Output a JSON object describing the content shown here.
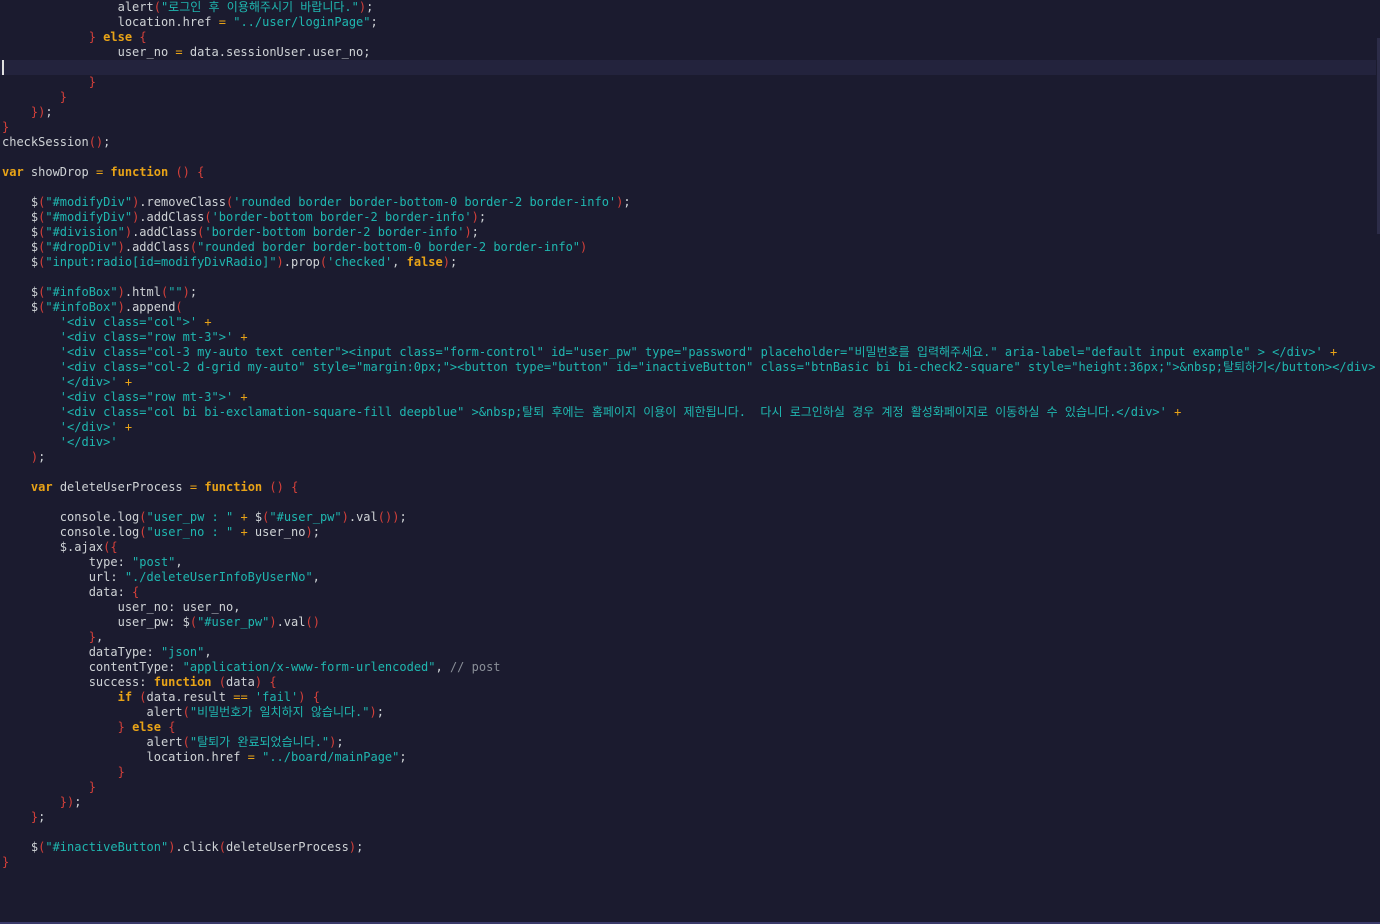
{
  "editor": {
    "lines": [
      [
        [
          "",
          "                "
        ],
        [
          "fn",
          "alert"
        ],
        [
          "br",
          "("
        ],
        [
          "str",
          "\"로그인 후 이용해주시기 바랍니다.\""
        ],
        [
          "br",
          ")"
        ],
        [
          "",
          ";"
        ]
      ],
      [
        [
          "",
          "                location.href "
        ],
        [
          "op",
          "="
        ],
        [
          "",
          " "
        ],
        [
          "str",
          "\"../user/loginPage\""
        ],
        [
          "",
          ";"
        ]
      ],
      [
        [
          "",
          "            "
        ],
        [
          "br",
          "}"
        ],
        [
          "",
          " "
        ],
        [
          "kw",
          "else"
        ],
        [
          "",
          " "
        ],
        [
          "br",
          "{"
        ]
      ],
      [
        [
          "",
          "                user_no "
        ],
        [
          "op",
          "="
        ],
        [
          "",
          " data.sessionUser.user_no;"
        ]
      ],
      [
        [
          "",
          ""
        ]
      ],
      [
        [
          "",
          "            "
        ],
        [
          "br",
          "}"
        ]
      ],
      [
        [
          "",
          "        "
        ],
        [
          "br",
          "}"
        ]
      ],
      [
        [
          "",
          "    "
        ],
        [
          "br",
          "})"
        ],
        [
          "",
          ";"
        ]
      ],
      [
        [
          "br",
          "}"
        ]
      ],
      [
        [
          "",
          "checkSession"
        ],
        [
          "br",
          "()"
        ],
        [
          "",
          ";"
        ]
      ],
      [
        [
          "",
          ""
        ]
      ],
      [
        [
          "kw",
          "var"
        ],
        [
          "",
          " showDrop "
        ],
        [
          "op",
          "="
        ],
        [
          "",
          " "
        ],
        [
          "kw",
          "function"
        ],
        [
          "",
          " "
        ],
        [
          "br",
          "()"
        ],
        [
          "",
          " "
        ],
        [
          "br",
          "{"
        ]
      ],
      [
        [
          "",
          ""
        ]
      ],
      [
        [
          "",
          "    $"
        ],
        [
          "br",
          "("
        ],
        [
          "str",
          "\"#modifyDiv\""
        ],
        [
          "br",
          ")"
        ],
        [
          "",
          ".removeClass"
        ],
        [
          "br",
          "("
        ],
        [
          "str",
          "'rounded border border-bottom-0 border-2 border-info'"
        ],
        [
          "br",
          ")"
        ],
        [
          "",
          ";"
        ]
      ],
      [
        [
          "",
          "    $"
        ],
        [
          "br",
          "("
        ],
        [
          "str",
          "\"#modifyDiv\""
        ],
        [
          "br",
          ")"
        ],
        [
          "",
          ".addClass"
        ],
        [
          "br",
          "("
        ],
        [
          "str",
          "'border-bottom border-2 border-info'"
        ],
        [
          "br",
          ")"
        ],
        [
          "",
          ";"
        ]
      ],
      [
        [
          "",
          "    $"
        ],
        [
          "br",
          "("
        ],
        [
          "str",
          "\"#division\""
        ],
        [
          "br",
          ")"
        ],
        [
          "",
          ".addClass"
        ],
        [
          "br",
          "("
        ],
        [
          "str",
          "'border-bottom border-2 border-info'"
        ],
        [
          "br",
          ")"
        ],
        [
          "",
          ";"
        ]
      ],
      [
        [
          "",
          "    $"
        ],
        [
          "br",
          "("
        ],
        [
          "str",
          "\"#dropDiv\""
        ],
        [
          "br",
          ")"
        ],
        [
          "",
          ".addClass"
        ],
        [
          "br",
          "("
        ],
        [
          "str",
          "\"rounded border border-bottom-0 border-2 border-info\""
        ],
        [
          "br",
          ")"
        ]
      ],
      [
        [
          "",
          "    $"
        ],
        [
          "br",
          "("
        ],
        [
          "str",
          "\"input:radio[id=modifyDivRadio]\""
        ],
        [
          "br",
          ")"
        ],
        [
          "",
          ".prop"
        ],
        [
          "br",
          "("
        ],
        [
          "str",
          "'checked'"
        ],
        [
          "",
          ", "
        ],
        [
          "kw",
          "false"
        ],
        [
          "br",
          ")"
        ],
        [
          "",
          ";"
        ]
      ],
      [
        [
          "",
          ""
        ]
      ],
      [
        [
          "",
          "    $"
        ],
        [
          "br",
          "("
        ],
        [
          "str",
          "\"#infoBox\""
        ],
        [
          "br",
          ")"
        ],
        [
          "",
          ".html"
        ],
        [
          "br",
          "("
        ],
        [
          "str",
          "\"\""
        ],
        [
          "br",
          ")"
        ],
        [
          "",
          ";"
        ]
      ],
      [
        [
          "",
          "    $"
        ],
        [
          "br",
          "("
        ],
        [
          "str",
          "\"#infoBox\""
        ],
        [
          "br",
          ")"
        ],
        [
          "",
          ".append"
        ],
        [
          "br",
          "("
        ]
      ],
      [
        [
          "",
          "        "
        ],
        [
          "str",
          "'<div class=\"col\">'"
        ],
        [
          "",
          " "
        ],
        [
          "op",
          "+"
        ]
      ],
      [
        [
          "",
          "        "
        ],
        [
          "str",
          "'<div class=\"row mt-3\">'"
        ],
        [
          "",
          " "
        ],
        [
          "op",
          "+"
        ]
      ],
      [
        [
          "",
          "        "
        ],
        [
          "str",
          "'<div class=\"col-3 my-auto text center\"><input class=\"form-control\" id=\"user_pw\" type=\"password\" placeholder=\"비밀번호를 입력해주세요.\" aria-label=\"default input example\" > </div>'"
        ],
        [
          "",
          " "
        ],
        [
          "op",
          "+"
        ]
      ],
      [
        [
          "",
          "        "
        ],
        [
          "str",
          "'<div class=\"col-2 d-grid my-auto\" style=\"margin:0px;\"><button type=\"button\" id=\"inactiveButton\" class=\"btnBasic bi bi-check2-square\" style=\"height:36px;\">&nbsp;탈퇴하기</button></div>'"
        ],
        [
          "",
          " "
        ],
        [
          "op",
          "+"
        ]
      ],
      [
        [
          "",
          "        "
        ],
        [
          "str",
          "'</div>'"
        ],
        [
          "",
          " "
        ],
        [
          "op",
          "+"
        ]
      ],
      [
        [
          "",
          "        "
        ],
        [
          "str",
          "'<div class=\"row mt-3\">'"
        ],
        [
          "",
          " "
        ],
        [
          "op",
          "+"
        ]
      ],
      [
        [
          "",
          "        "
        ],
        [
          "str",
          "'<div class=\"col bi bi-exclamation-square-fill deepblue\" >&nbsp;탈퇴 후에는 홈페이지 이용이 제한됩니다.  다시 로그인하실 경우 계정 활성화페이지로 이동하실 수 있습니다.</div>'"
        ],
        [
          "",
          " "
        ],
        [
          "op",
          "+"
        ]
      ],
      [
        [
          "",
          "        "
        ],
        [
          "str",
          "'</div>'"
        ],
        [
          "",
          " "
        ],
        [
          "op",
          "+"
        ]
      ],
      [
        [
          "",
          "        "
        ],
        [
          "str",
          "'</div>'"
        ]
      ],
      [
        [
          "",
          "    "
        ],
        [
          "br",
          ")"
        ],
        [
          "",
          ";"
        ]
      ],
      [
        [
          "",
          ""
        ]
      ],
      [
        [
          "",
          "    "
        ],
        [
          "kw",
          "var"
        ],
        [
          "",
          " deleteUserProcess "
        ],
        [
          "op",
          "="
        ],
        [
          "",
          " "
        ],
        [
          "kw",
          "function"
        ],
        [
          "",
          " "
        ],
        [
          "br",
          "()"
        ],
        [
          "",
          " "
        ],
        [
          "br",
          "{"
        ]
      ],
      [
        [
          "",
          ""
        ]
      ],
      [
        [
          "",
          "        console.log"
        ],
        [
          "br",
          "("
        ],
        [
          "str",
          "\"user_pw : \""
        ],
        [
          "",
          " "
        ],
        [
          "op",
          "+"
        ],
        [
          "",
          " $"
        ],
        [
          "br",
          "("
        ],
        [
          "str",
          "\"#user_pw\""
        ],
        [
          "br",
          ")"
        ],
        [
          "",
          ".val"
        ],
        [
          "br",
          "())"
        ],
        [
          "",
          ";"
        ]
      ],
      [
        [
          "",
          "        console.log"
        ],
        [
          "br",
          "("
        ],
        [
          "str",
          "\"user_no : \""
        ],
        [
          "",
          " "
        ],
        [
          "op",
          "+"
        ],
        [
          "",
          " user_no"
        ],
        [
          "br",
          ")"
        ],
        [
          "",
          ";"
        ]
      ],
      [
        [
          "",
          "        $.ajax"
        ],
        [
          "br",
          "({"
        ]
      ],
      [
        [
          "",
          "            type: "
        ],
        [
          "str",
          "\"post\""
        ],
        [
          "",
          ","
        ]
      ],
      [
        [
          "",
          "            url: "
        ],
        [
          "str",
          "\"./deleteUserInfoByUserNo\""
        ],
        [
          "",
          ","
        ]
      ],
      [
        [
          "",
          "            data: "
        ],
        [
          "br",
          "{"
        ]
      ],
      [
        [
          "",
          "                user_no: user_no,"
        ]
      ],
      [
        [
          "",
          "                user_pw: $"
        ],
        [
          "br",
          "("
        ],
        [
          "str",
          "\"#user_pw\""
        ],
        [
          "br",
          ")"
        ],
        [
          "",
          ".val"
        ],
        [
          "br",
          "()"
        ]
      ],
      [
        [
          "",
          "            "
        ],
        [
          "br",
          "}"
        ],
        [
          "",
          ","
        ]
      ],
      [
        [
          "",
          "            dataType: "
        ],
        [
          "str",
          "\"json\""
        ],
        [
          "",
          ","
        ]
      ],
      [
        [
          "",
          "            contentType: "
        ],
        [
          "str",
          "\"application/x-www-form-urlencoded\""
        ],
        [
          "",
          ", "
        ],
        [
          "cm",
          "// post"
        ]
      ],
      [
        [
          "",
          "            success: "
        ],
        [
          "kw",
          "function"
        ],
        [
          "",
          " "
        ],
        [
          "br",
          "("
        ],
        [
          "",
          "data"
        ],
        [
          "br",
          ")"
        ],
        [
          "",
          " "
        ],
        [
          "br",
          "{"
        ]
      ],
      [
        [
          "",
          "                "
        ],
        [
          "kw",
          "if"
        ],
        [
          "",
          " "
        ],
        [
          "br",
          "("
        ],
        [
          "",
          "data.result "
        ],
        [
          "op",
          "=="
        ],
        [
          "",
          " "
        ],
        [
          "str",
          "'fail'"
        ],
        [
          "br",
          ")"
        ],
        [
          "",
          " "
        ],
        [
          "br",
          "{"
        ]
      ],
      [
        [
          "",
          "                    alert"
        ],
        [
          "br",
          "("
        ],
        [
          "str",
          "\"비밀번호가 일치하지 않습니다.\""
        ],
        [
          "br",
          ")"
        ],
        [
          "",
          ";"
        ]
      ],
      [
        [
          "",
          "                "
        ],
        [
          "br",
          "}"
        ],
        [
          "",
          " "
        ],
        [
          "kw",
          "else"
        ],
        [
          "",
          " "
        ],
        [
          "br",
          "{"
        ]
      ],
      [
        [
          "",
          "                    alert"
        ],
        [
          "br",
          "("
        ],
        [
          "str",
          "\"탈퇴가 완료되었습니다.\""
        ],
        [
          "br",
          ")"
        ],
        [
          "",
          ";"
        ]
      ],
      [
        [
          "",
          "                    location.href "
        ],
        [
          "op",
          "="
        ],
        [
          "",
          " "
        ],
        [
          "str",
          "\"../board/mainPage\""
        ],
        [
          "",
          ";"
        ]
      ],
      [
        [
          "",
          "                "
        ],
        [
          "br",
          "}"
        ]
      ],
      [
        [
          "",
          "            "
        ],
        [
          "br",
          "}"
        ]
      ],
      [
        [
          "",
          "        "
        ],
        [
          "br",
          "})"
        ],
        [
          "",
          ";"
        ]
      ],
      [
        [
          "",
          "    "
        ],
        [
          "br",
          "}"
        ],
        [
          "",
          ";"
        ]
      ],
      [
        [
          "",
          ""
        ]
      ],
      [
        [
          "",
          "    $"
        ],
        [
          "br",
          "("
        ],
        [
          "str",
          "\"#inactiveButton\""
        ],
        [
          "br",
          ")"
        ],
        [
          "",
          ".click"
        ],
        [
          "br",
          "("
        ],
        [
          "",
          "deleteUserProcess"
        ],
        [
          "br",
          ")"
        ],
        [
          "",
          ";"
        ]
      ],
      [
        [
          "br",
          "}"
        ]
      ]
    ],
    "current_line_index": 4,
    "colors": {
      "background": "#1b1b2f",
      "keyword": "#e8a317",
      "string": "#1fb7b0",
      "bracket": "#d5403a",
      "text": "#cfd3d6",
      "comment": "#8a8f98"
    }
  }
}
